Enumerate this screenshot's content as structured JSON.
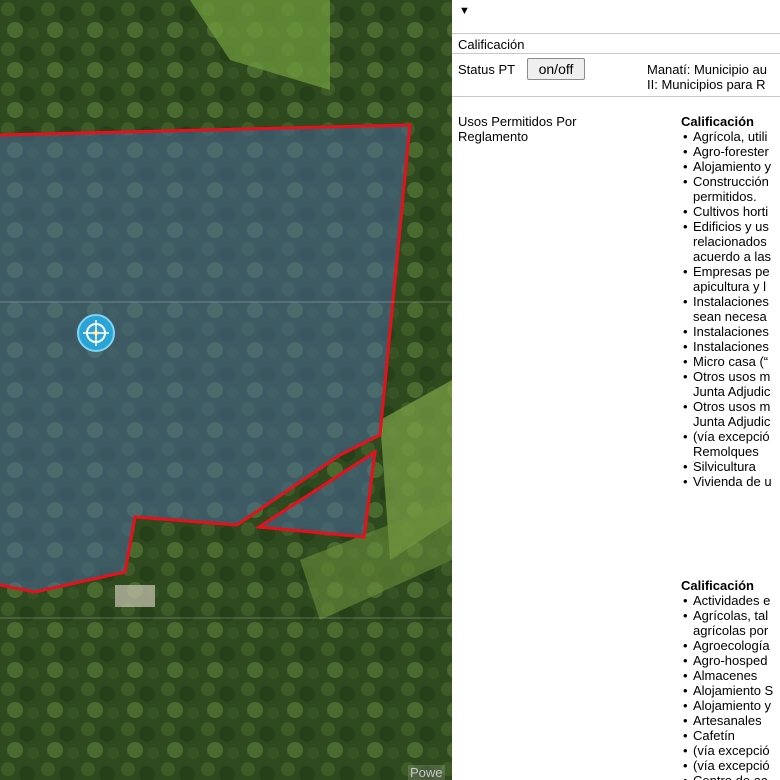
{
  "map": {
    "attribution": "Powe"
  },
  "panel": {
    "caret": "▼",
    "calificacion_label": "Calificación",
    "status_label": "Status PT",
    "status_button": "on/off",
    "status_desc_1": "Manatí: Municipio au",
    "status_desc_2": "II: Municipios para R",
    "usos_label_1": "Usos Permitidos Por",
    "usos_label_2": "Reglamento",
    "section1_title": "Calificación",
    "section1_items": [
      "Agrícola, utili",
      "Agro-forester",
      "Alojamiento y",
      "Construcción|permitidos.",
      "Cultivos horti",
      "Edificios y us|relacionados|acuerdo a las",
      "Empresas pe|apicultura y l",
      "Instalaciones|sean necesa",
      "Instalaciones",
      "Instalaciones",
      "Micro casa (“",
      "Otros usos m|Junta Adjudic",
      "Otros usos m|Junta Adjudic",
      "(vía excepció|Remolques",
      "Silvicultura",
      "Vivienda de u"
    ],
    "section2_title": "Calificación",
    "section2_items": [
      "Actividades e",
      "Agrícolas, tal|agrícolas por",
      "Agroecología",
      "Agro-hosped",
      "Almacenes",
      "Alojamiento S",
      "Alojamiento y",
      "Artesanales",
      "Cafetín",
      "(vía excepció",
      "(vía excepció",
      "Centro de ac"
    ]
  }
}
